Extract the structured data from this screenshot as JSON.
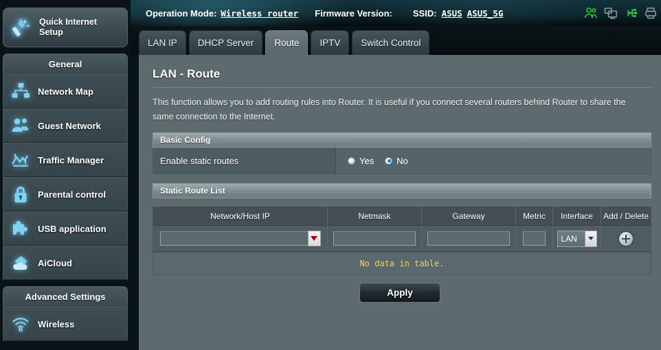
{
  "header": {
    "operation_mode_label": "Operation Mode:",
    "operation_mode_value": "Wireless router",
    "firmware_label": "Firmware Version:",
    "firmware_value": "",
    "ssid_label": "SSID:",
    "ssid_1": "ASUS",
    "ssid_2": "ASUS_5G",
    "icons": [
      {
        "name": "clients-users-icon",
        "color": "#36c23a"
      },
      {
        "name": "monitors-screens-icon",
        "color": "#8a9699"
      },
      {
        "name": "usb-icon",
        "color": "#36c23a"
      },
      {
        "name": "printer-icon",
        "color": "#8a9699"
      }
    ]
  },
  "tabs": [
    {
      "label": "LAN IP",
      "active": false
    },
    {
      "label": "DHCP Server",
      "active": false
    },
    {
      "label": "Route",
      "active": true
    },
    {
      "label": "IPTV",
      "active": false
    },
    {
      "label": "Switch Control",
      "active": false
    }
  ],
  "sidebar": {
    "quick_setup": {
      "line1": "Quick Internet",
      "line2": "Setup",
      "icon": "magic-wand-icon"
    },
    "group_general": "General",
    "general_items": [
      {
        "label": "Network Map",
        "icon": "network-map-icon"
      },
      {
        "label": "Guest Network",
        "icon": "guest-network-icon"
      },
      {
        "label": "Traffic Manager",
        "icon": "traffic-manager-icon"
      },
      {
        "label": "Parental control",
        "icon": "lock-icon"
      },
      {
        "label": "USB application",
        "icon": "puzzle-piece-icon"
      },
      {
        "label": "AiCloud",
        "icon": "aicloud-icon"
      }
    ],
    "group_advanced": "Advanced Settings",
    "advanced_items": [
      {
        "label": "Wireless",
        "icon": "wifi-icon"
      }
    ]
  },
  "main": {
    "page_title": "LAN - Route",
    "description": "This function allows you to add routing rules into Router. It is useful if you connect several routers behind Router to share the same connection to the Internet.",
    "basic_config": {
      "section_title": "Basic Config",
      "row_label": "Enable static routes",
      "option_yes": "Yes",
      "option_no": "No",
      "selected": "No"
    },
    "static_route_list": {
      "section_title": "Static Route List",
      "columns": [
        "Network/Host IP",
        "Netmask",
        "Gateway",
        "Metric",
        "Interface",
        "Add / Delete"
      ],
      "input_row": {
        "network_host_ip": "",
        "netmask": "",
        "gateway": "",
        "metric": "",
        "interface": "LAN",
        "add_icon": "plus-circle-icon"
      },
      "empty_message": "No data in table."
    },
    "apply_label": "Apply"
  },
  "colors": {
    "panel_bg": "#5d6a6e",
    "header_teal": "#123039",
    "accent_blue": "#1683c4",
    "warning_yellow": "#e8d35c",
    "icon_glow": "#6ecdf5"
  }
}
